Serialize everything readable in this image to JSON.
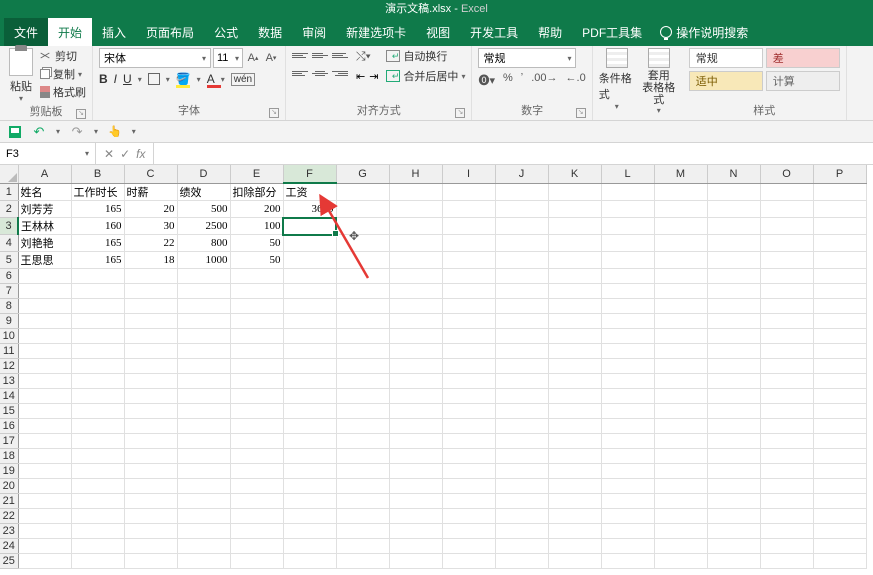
{
  "title": {
    "doc": "演示文稿.xlsx",
    "sep": " - ",
    "app": "Excel"
  },
  "tabs": {
    "file": "文件",
    "home": "开始",
    "insert": "插入",
    "layout": "页面布局",
    "formulas": "公式",
    "data": "数据",
    "review": "审阅",
    "newtab": "新建选项卡",
    "view": "视图",
    "dev": "开发工具",
    "help": "帮助",
    "pdf": "PDF工具集",
    "tellme": "操作说明搜索"
  },
  "ribbon": {
    "clipboard": {
      "paste": "粘贴",
      "cut": "剪切",
      "copy": "复制",
      "format_painter": "格式刷",
      "label": "剪贴板"
    },
    "font": {
      "name": "宋体",
      "size": "11",
      "label": "字体"
    },
    "align": {
      "wrap": "自动换行",
      "merge": "合并后居中",
      "label": "对齐方式"
    },
    "number": {
      "format": "常规",
      "label": "数字"
    },
    "styles": {
      "cond": "条件格式",
      "table": "套用\n表格格式",
      "normal": "常规",
      "bad": "差",
      "good": "适中",
      "calc": "计算",
      "label": "样式"
    }
  },
  "namebox": "F3",
  "fx": "fx",
  "columns": [
    "A",
    "B",
    "C",
    "D",
    "E",
    "F",
    "G",
    "H",
    "I",
    "J",
    "K",
    "L",
    "M",
    "N",
    "O",
    "P"
  ],
  "rows_count": 25,
  "selected": {
    "col": 5,
    "row": 3
  },
  "data": {
    "headers": [
      "姓名",
      "工作时长",
      "时薪",
      "绩效",
      "扣除部分",
      "工资"
    ],
    "rows": [
      [
        "刘芳芳",
        "165",
        "20",
        "500",
        "200",
        "3600"
      ],
      [
        "王林林",
        "160",
        "30",
        "2500",
        "100",
        ""
      ],
      [
        "刘艳艳",
        "165",
        "22",
        "800",
        "50",
        ""
      ],
      [
        "王思思",
        "165",
        "18",
        "1000",
        "50",
        ""
      ]
    ]
  }
}
